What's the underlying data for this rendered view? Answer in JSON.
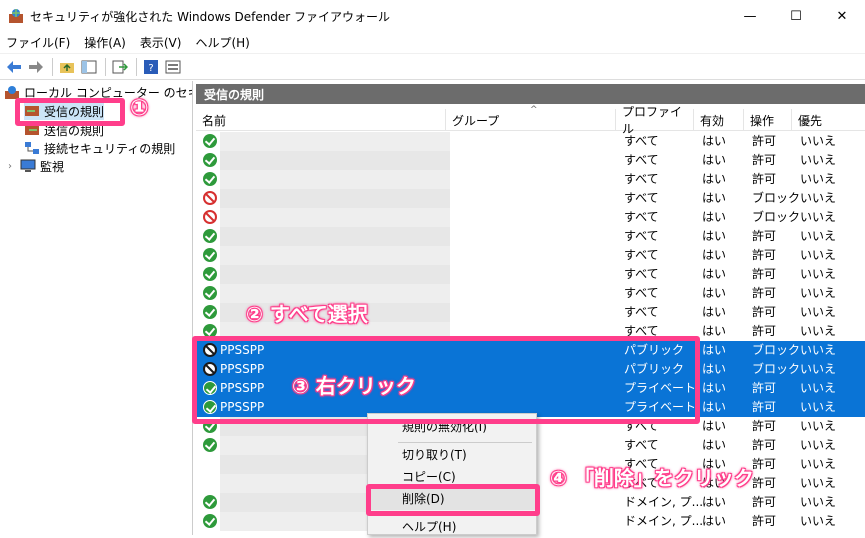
{
  "window": {
    "title": "セキュリティが強化された Windows Defender ファイアウォール",
    "minimize": "—",
    "maximize": "☐",
    "close": "✕"
  },
  "menu": [
    "ファイル(F)",
    "操作(A)",
    "表示(V)",
    "ヘルプ(H)"
  ],
  "toolbar_icons": [
    "back-arrow-icon",
    "forward-arrow-icon",
    "folder-up-icon",
    "show-hide-tree-icon",
    "export-icon",
    "help-icon",
    "properties-icon"
  ],
  "tree": {
    "root": "ローカル コンピューター のセキュリティ",
    "inbound": "受信の規則",
    "outbound": "送信の規則",
    "connection": "接続セキュリティの規則",
    "monitor": "監視"
  },
  "pane": {
    "title": "受信の規則"
  },
  "columns": {
    "name": "名前",
    "group": "グループ",
    "profile": "プロファイル",
    "enabled": "有効",
    "action": "操作",
    "override": "優先"
  },
  "rules": [
    {
      "name": "",
      "status": "allow",
      "profile": "すべて",
      "enabled": "はい",
      "action": "許可",
      "override": "いいえ",
      "selected": false
    },
    {
      "name": "",
      "status": "allow",
      "profile": "すべて",
      "enabled": "はい",
      "action": "許可",
      "override": "いいえ",
      "selected": false
    },
    {
      "name": "",
      "status": "allow",
      "profile": "すべて",
      "enabled": "はい",
      "action": "許可",
      "override": "いいえ",
      "selected": false
    },
    {
      "name": "",
      "status": "block",
      "profile": "すべて",
      "enabled": "はい",
      "action": "ブロック",
      "override": "いいえ",
      "selected": false
    },
    {
      "name": "",
      "status": "block",
      "profile": "すべて",
      "enabled": "はい",
      "action": "ブロック",
      "override": "いいえ",
      "selected": false
    },
    {
      "name": "",
      "status": "allow",
      "profile": "すべて",
      "enabled": "はい",
      "action": "許可",
      "override": "いいえ",
      "selected": false
    },
    {
      "name": "",
      "status": "allow",
      "profile": "すべて",
      "enabled": "はい",
      "action": "許可",
      "override": "いいえ",
      "selected": false
    },
    {
      "name": "",
      "status": "allow",
      "profile": "すべて",
      "enabled": "はい",
      "action": "許可",
      "override": "いいえ",
      "selected": false
    },
    {
      "name": "",
      "status": "allow",
      "profile": "すべて",
      "enabled": "はい",
      "action": "許可",
      "override": "いいえ",
      "selected": false
    },
    {
      "name": "",
      "status": "allow",
      "profile": "すべて",
      "enabled": "はい",
      "action": "許可",
      "override": "いいえ",
      "selected": false
    },
    {
      "name": "",
      "status": "allow",
      "profile": "すべて",
      "enabled": "はい",
      "action": "許可",
      "override": "いいえ",
      "selected": false
    },
    {
      "name": "PPSSPP",
      "status": "block",
      "profile": "パブリック",
      "enabled": "はい",
      "action": "ブロック",
      "override": "いいえ",
      "selected": true
    },
    {
      "name": "PPSSPP",
      "status": "block",
      "profile": "パブリック",
      "enabled": "はい",
      "action": "ブロック",
      "override": "いいえ",
      "selected": true
    },
    {
      "name": "PPSSPP",
      "status": "allow",
      "profile": "プライベート",
      "enabled": "はい",
      "action": "許可",
      "override": "いいえ",
      "selected": true
    },
    {
      "name": "PPSSPP",
      "status": "allow",
      "profile": "プライベート",
      "enabled": "はい",
      "action": "許可",
      "override": "いいえ",
      "selected": true
    },
    {
      "name": "",
      "status": "allow",
      "profile": "すべて",
      "enabled": "はい",
      "action": "許可",
      "override": "いいえ",
      "selected": false
    },
    {
      "name": "",
      "status": "allow",
      "profile": "すべて",
      "enabled": "はい",
      "action": "許可",
      "override": "いいえ",
      "selected": false
    },
    {
      "name": "",
      "status": "none",
      "profile": "すべて",
      "enabled": "はい",
      "action": "許可",
      "override": "いいえ",
      "selected": false
    },
    {
      "name": "",
      "status": "none",
      "profile": "すべて",
      "enabled": "はい",
      "action": "許可",
      "override": "いいえ",
      "selected": false
    },
    {
      "name": "",
      "status": "allow",
      "profile": "ドメイン, プ...",
      "enabled": "はい",
      "action": "許可",
      "override": "いいえ",
      "selected": false
    },
    {
      "name": "",
      "status": "allow",
      "profile": "ドメイン, プ...",
      "enabled": "はい",
      "action": "許可",
      "override": "いいえ",
      "selected": false
    }
  ],
  "context_menu": {
    "disable": "規則の無効化(I)",
    "cut": "切り取り(T)",
    "copy": "コピー(C)",
    "delete": "削除(D)",
    "help": "ヘルプ(H)"
  },
  "annotations": {
    "step1": "①",
    "step2": "② すべて選択",
    "step3": "③ 右クリック",
    "step4": "④ 「削除」をクリック",
    "color": "#ff3e8b"
  }
}
